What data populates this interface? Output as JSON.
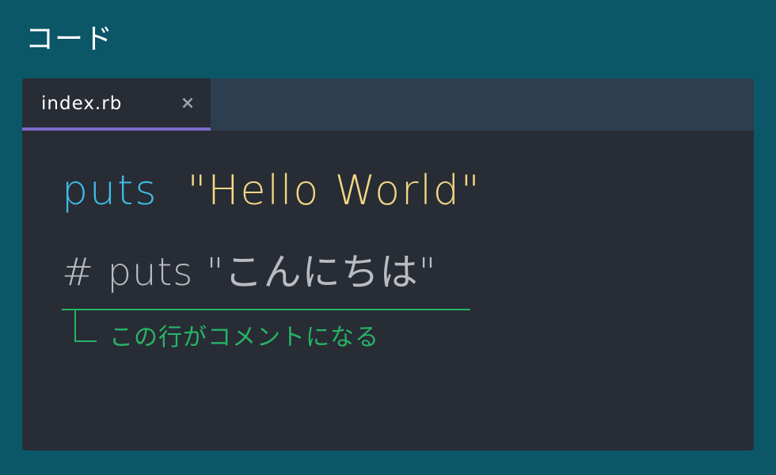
{
  "heading": "コード",
  "editor": {
    "tab": {
      "filename": "index.rb",
      "close_glyph": "×"
    },
    "code": {
      "line1_keyword": "puts",
      "line1_string": "\"Hello World\"",
      "line2_comment": "# puts \"こんにちは\""
    },
    "annotation": "この行がコメントになる"
  },
  "colors": {
    "background": "#0b5667",
    "editor_bg": "#282c34",
    "tab_bar_bg": "#2c3e50",
    "tab_underline": "#7e6ac8",
    "keyword": "#3ebbe6",
    "string": "#f2d784",
    "comment": "#b8bcc2",
    "annotation": "#27b367"
  }
}
